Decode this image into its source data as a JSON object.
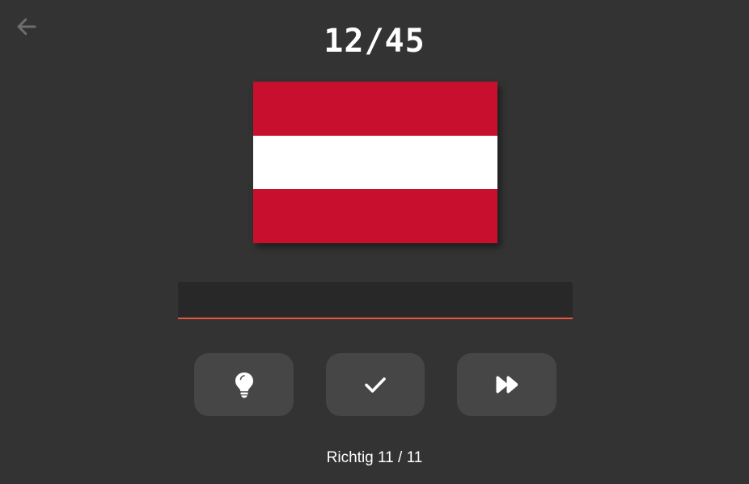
{
  "header": {
    "progress": "12/45",
    "back_icon": "arrow-left-icon"
  },
  "flag": {
    "country_stripes": [
      "#c8102e",
      "#ffffff",
      "#c8102e"
    ]
  },
  "answer": {
    "value": "",
    "placeholder": "",
    "accent_color": "#e8553e"
  },
  "actions": [
    {
      "name": "hint",
      "icon": "lightbulb-icon"
    },
    {
      "name": "check",
      "icon": "checkmark-icon"
    },
    {
      "name": "skip",
      "icon": "fast-forward-icon"
    }
  ],
  "footer": {
    "score_text": "Richtig 11 / 11"
  }
}
